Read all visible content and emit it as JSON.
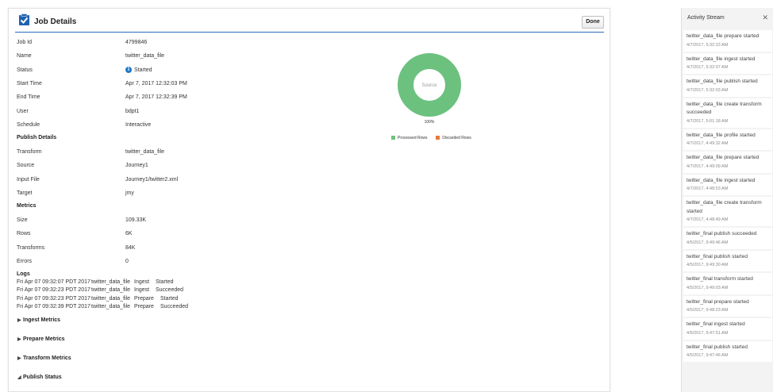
{
  "header": {
    "title": "Job Details",
    "done_label": "Done",
    "icon": "clipboard-check-icon",
    "accent": "#2a6ebb"
  },
  "details": [
    {
      "label": "Job Id",
      "value": "4799846"
    },
    {
      "label": "Name",
      "value": "twitter_data_file"
    },
    {
      "label": "Status",
      "value": "Started",
      "icon": "info-icon"
    },
    {
      "label": "Start Time",
      "value": "Apr 7, 2017 12:32:03 PM"
    },
    {
      "label": "End Time",
      "value": "Apr 7, 2017 12:32:39 PM"
    },
    {
      "label": "User",
      "value": "bdpt1"
    },
    {
      "label": "Schedule",
      "value": "Interactive"
    }
  ],
  "publish_details": {
    "title": "Publish Details",
    "rows": [
      {
        "label": "Transform",
        "value": "twitter_data_file"
      },
      {
        "label": "Source",
        "value": "Journey1"
      },
      {
        "label": "Input File",
        "value": "Journey1/twitter2.xml"
      },
      {
        "label": "Target",
        "value": "jmy"
      }
    ]
  },
  "metrics": {
    "title": "Metrics",
    "rows": [
      {
        "label": "Size",
        "value": "109.33K"
      },
      {
        "label": "Rows",
        "value": "6K"
      },
      {
        "label": "Transforms",
        "value": "84K"
      },
      {
        "label": "Errors",
        "value": "0"
      }
    ]
  },
  "logs": {
    "title": "Logs",
    "entries": [
      {
        "time": "Fri Apr 07 09:32:07 PDT 2017",
        "name": "twitter_data_file",
        "phase": "Ingest",
        "status": "Started"
      },
      {
        "time": "Fri Apr 07 09:32:23 PDT 2017",
        "name": "twitter_data_file",
        "phase": "Ingest",
        "status": "Succeeded"
      },
      {
        "time": "Fri Apr 07 09:32:23 PDT 2017",
        "name": "twitter_data_file",
        "phase": "Prepare",
        "status": "Started"
      },
      {
        "time": "Fri Apr 07 09:32:39 PDT 2017",
        "name": "twitter_data_file",
        "phase": "Prepare",
        "status": "Succeeded"
      }
    ]
  },
  "sections": [
    {
      "label": "Ingest Metrics",
      "expanded": false
    },
    {
      "label": "Prepare Metrics",
      "expanded": false
    },
    {
      "label": "Transform Metrics",
      "expanded": false
    },
    {
      "label": "Publish Status",
      "expanded": true
    }
  ],
  "chart_data": {
    "type": "pie",
    "center_label": "Source",
    "slice_label": "100%",
    "series": [
      {
        "name": "Processed Rows",
        "value": 100,
        "color": "#6cc17f"
      },
      {
        "name": "Discarded Rows",
        "value": 0,
        "color": "#e8793a"
      }
    ]
  },
  "activity_stream": {
    "title": "Activity Stream",
    "items": [
      {
        "text": "twitter_data_file prepare started",
        "date": "4/7/2017, 5:32:23 AM"
      },
      {
        "text": "twitter_data_file ingest started",
        "date": "4/7/2017, 5:32:07 AM"
      },
      {
        "text": "twitter_data_file publish started",
        "date": "4/7/2017, 5:32:03 AM"
      },
      {
        "text": "twitter_data_file create transform succeeded",
        "date": "4/7/2017, 5:01:18 AM"
      },
      {
        "text": "twitter_data_file profile started",
        "date": "4/7/2017, 4:49:32 AM"
      },
      {
        "text": "twitter_data_file prepare started",
        "date": "4/7/2017, 4:49:09 AM"
      },
      {
        "text": "twitter_data_file ingest started",
        "date": "4/7/2017, 4:48:53 AM"
      },
      {
        "text": "twitter_data_file create transform started",
        "date": "4/7/2017, 4:48:49 AM"
      },
      {
        "text": "twitter_final publish succeeded",
        "date": "4/5/2017, 9:49:46 AM"
      },
      {
        "text": "twitter_final publish started",
        "date": "4/5/2017, 9:49:30 AM"
      },
      {
        "text": "twitter_final transform started",
        "date": "4/5/2017, 9:49:03 AM"
      },
      {
        "text": "twitter_final prepare started",
        "date": "4/5/2017, 9:48:23 AM"
      },
      {
        "text": "twitter_final ingest started",
        "date": "4/5/2017, 9:47:51 AM"
      },
      {
        "text": "twitter_final publish started",
        "date": "4/5/2017, 9:47:46 AM"
      }
    ]
  }
}
